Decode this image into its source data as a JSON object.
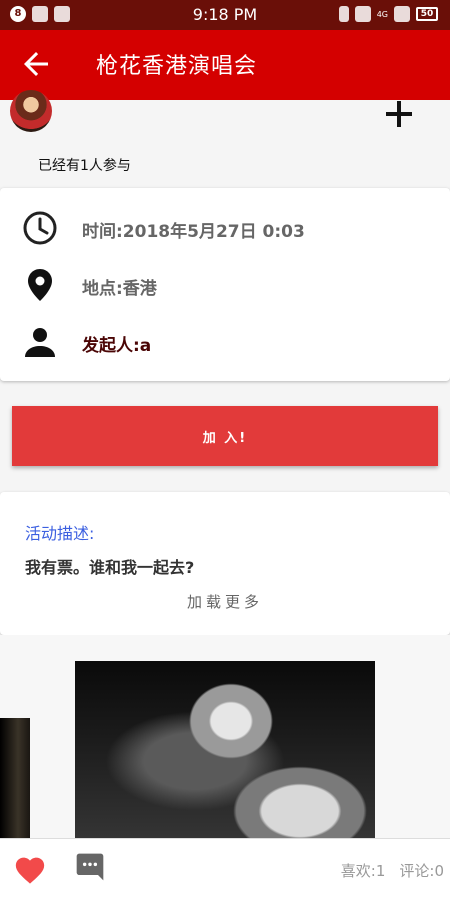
{
  "status_bar": {
    "time": "9:18 PM",
    "notif_badge": "8",
    "network": "4G",
    "battery": "50"
  },
  "app_bar": {
    "title": "枪花香港演唱会"
  },
  "participants": {
    "joined_text": "已经有1人参与"
  },
  "info": {
    "time_label": "时间:2018年5月27日 0:03",
    "location_label": "地点:香港",
    "organizer_label": "发起人:a"
  },
  "join_button": {
    "label": "加 入!"
  },
  "description": {
    "label": "活动描述:",
    "text": "我有票。谁和我一起去?",
    "load_more": "加载更多"
  },
  "bottom_bar": {
    "likes": "喜欢:1",
    "comments": "评论:0"
  },
  "colors": {
    "app_bar": "#d40000",
    "status_bar": "#6a0f08",
    "join_button": "#e23a3a",
    "heart": "#f24a4a",
    "desc_label": "#3b5fe0"
  },
  "icons": [
    "back-arrow-icon",
    "plus-icon",
    "clock-icon",
    "location-pin-icon",
    "person-icon",
    "heart-icon",
    "comment-icon"
  ]
}
